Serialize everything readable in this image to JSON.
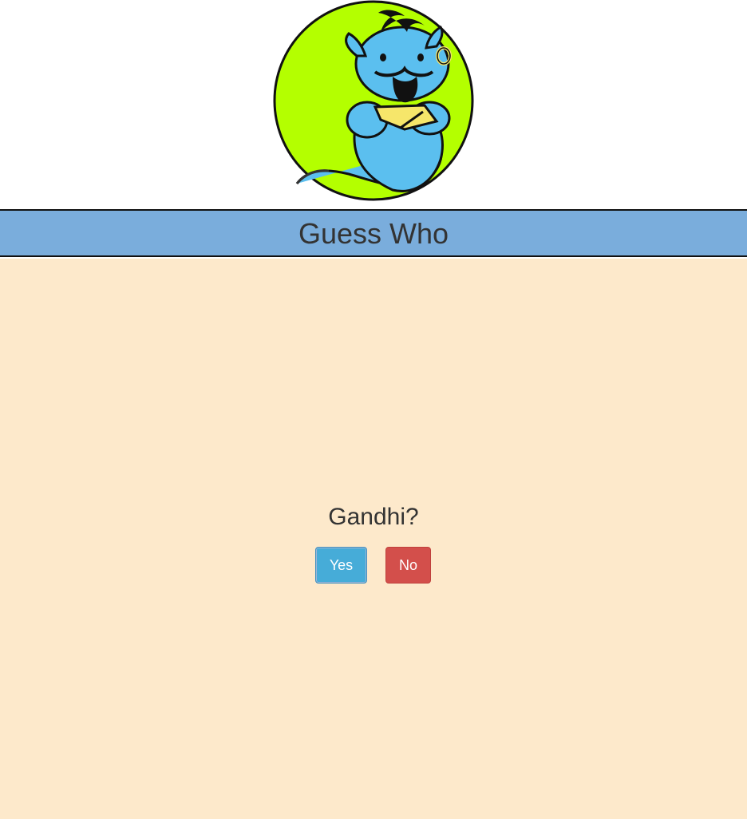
{
  "app": {
    "title": "Guess Who"
  },
  "logo": {
    "name": "genie-logo",
    "colors": {
      "circle_fill": "#b4ff00",
      "genie_body": "#5bbfef",
      "accent": "#f6e66a",
      "outline": "#111111"
    }
  },
  "header": {
    "title": "Guess Who",
    "background": "#7aaddc"
  },
  "main": {
    "background": "#fde9cb",
    "question": "Gandhi?",
    "buttons": {
      "yes_label": "Yes",
      "no_label": "No",
      "yes_color": "#46acd8",
      "no_color": "#d34f4b"
    }
  }
}
